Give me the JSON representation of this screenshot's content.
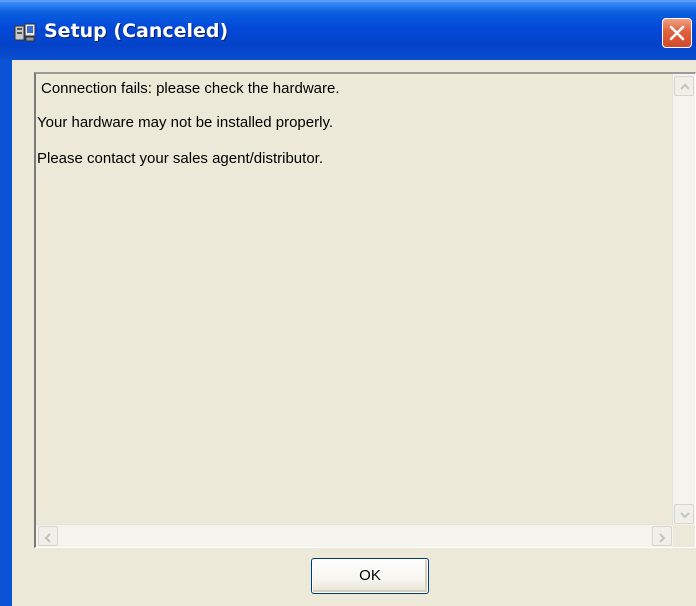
{
  "window": {
    "title": "Setup (Canceled)",
    "icon": "setup-app-icon",
    "close_icon": "close-icon"
  },
  "message": {
    "lines": [
      "Connection fails: please check the hardware.",
      "Your hardware may not be installed properly.",
      "Please contact your sales agent/distributor."
    ]
  },
  "buttons": {
    "ok_label": "OK"
  },
  "colors": {
    "titlebar": "#0348d8",
    "dialog_background": "#ece9d8",
    "close_button": "#e0603c"
  }
}
